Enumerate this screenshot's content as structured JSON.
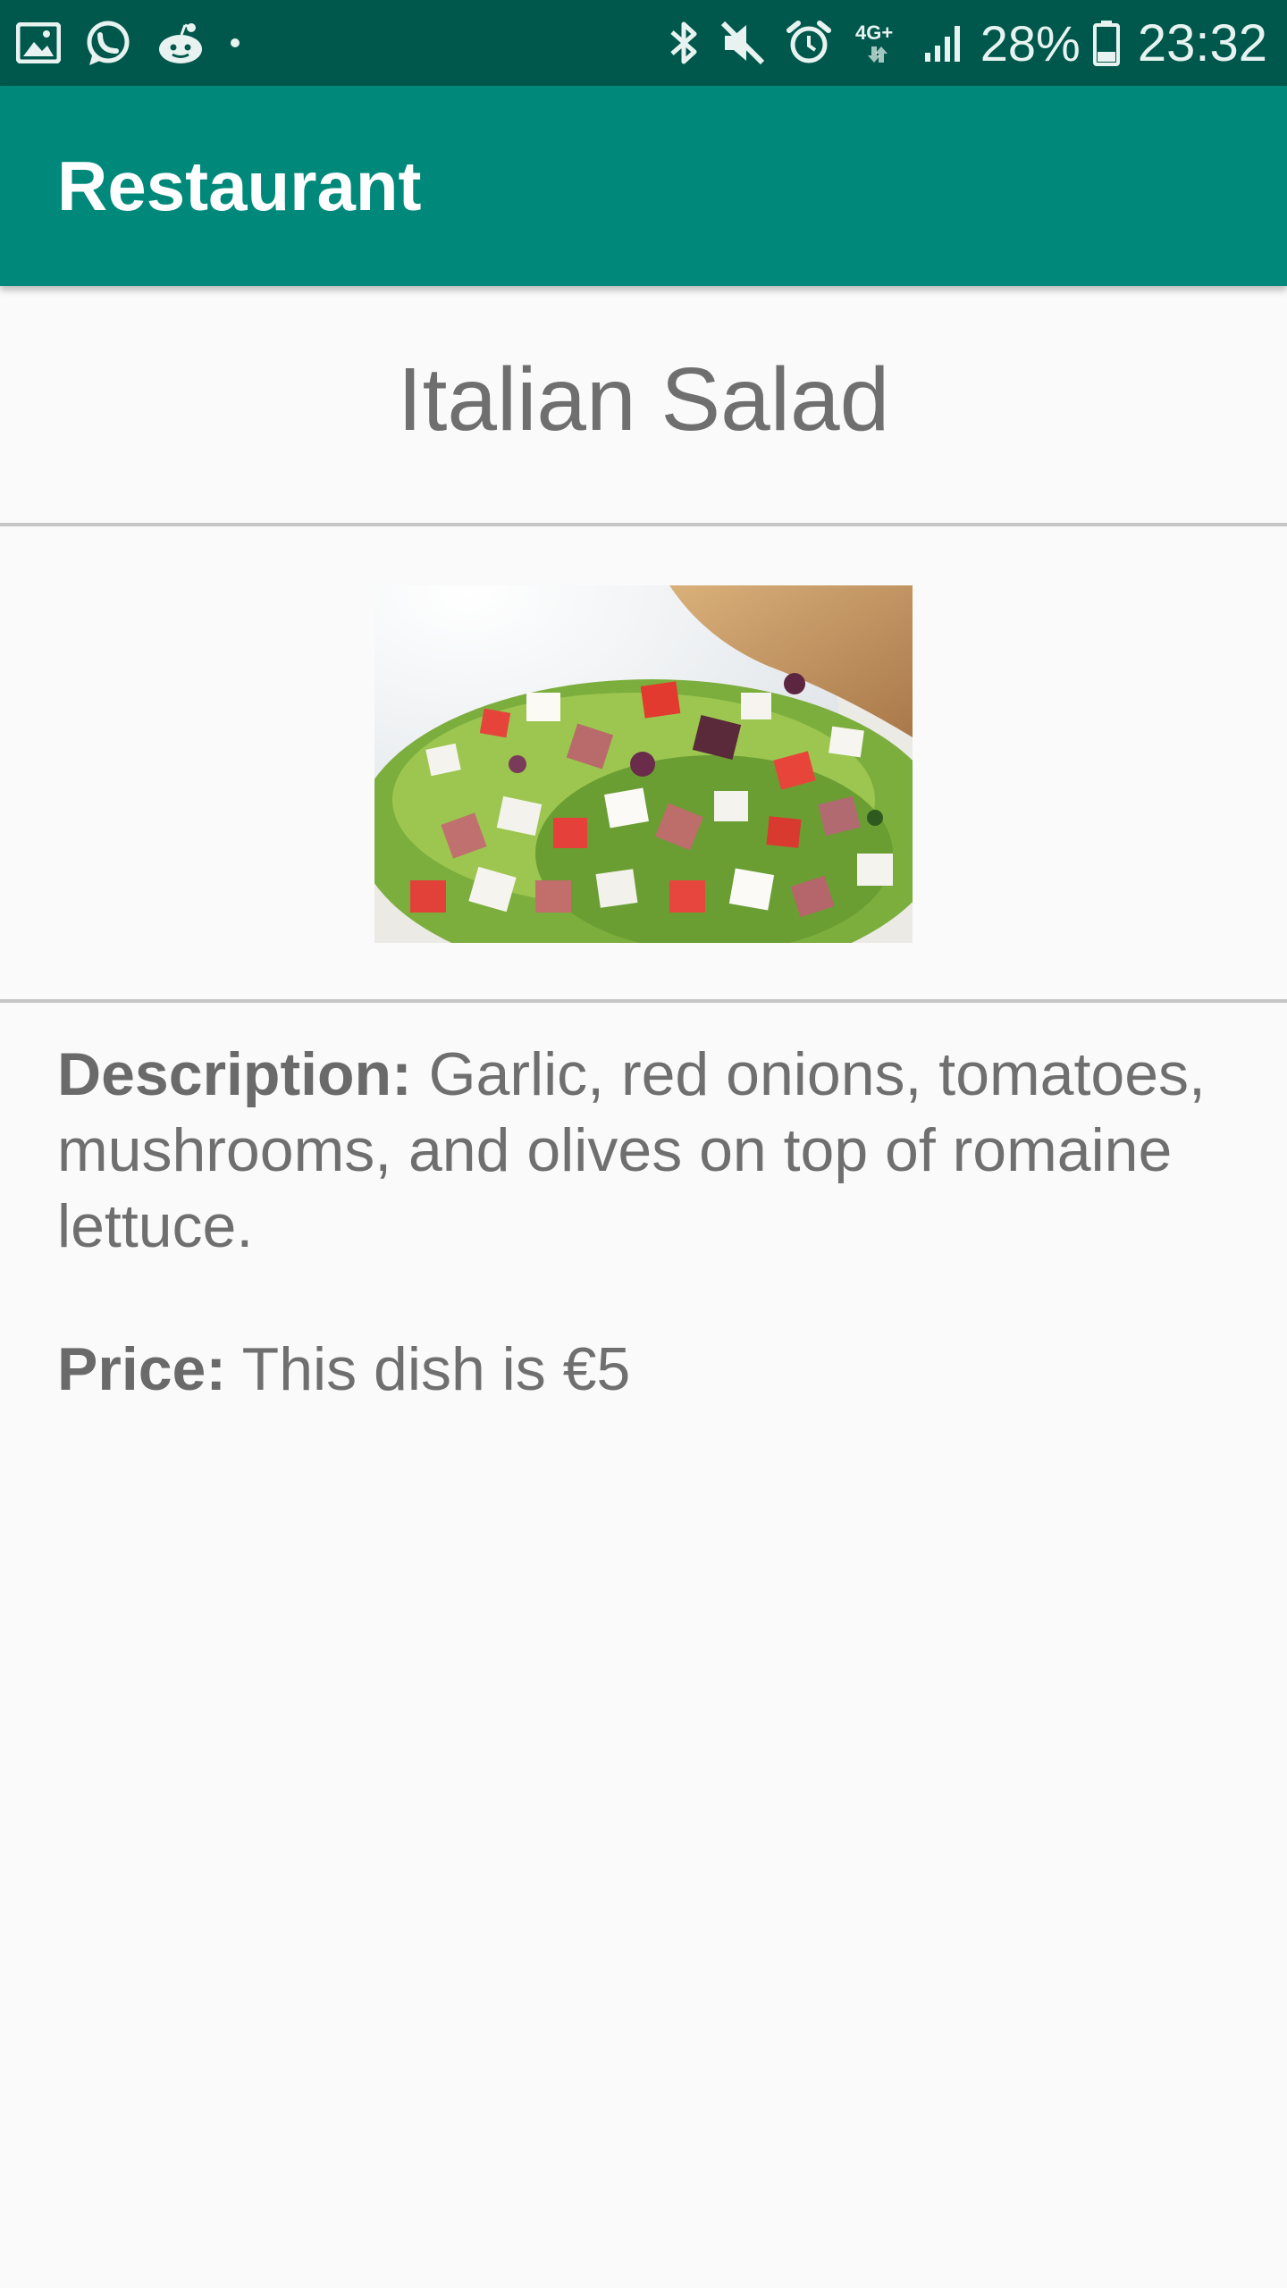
{
  "status_bar": {
    "left_icons": [
      "gallery-icon",
      "whatsapp-icon",
      "reddit-icon",
      "dot-icon"
    ],
    "right_icons": [
      "bluetooth-icon",
      "mute-icon",
      "alarm-icon",
      "4g-icon",
      "signal-icon"
    ],
    "network": "4G+",
    "battery": "28%",
    "time": "23:32"
  },
  "app_bar": {
    "title": "Restaurant"
  },
  "dish": {
    "name": "Italian Salad",
    "description_label": "Description:",
    "description_text": " Garlic, red onions, tomatoes, mushrooms, and olives on top of romaine lettuce.",
    "price_label": "Price:",
    "price_text": " This dish is €5"
  },
  "colors": {
    "status_bar": "#00584c",
    "app_bar": "#00897b",
    "background": "#fafafa",
    "text": "#6f6f6f",
    "divider": "#c6c6c6"
  }
}
